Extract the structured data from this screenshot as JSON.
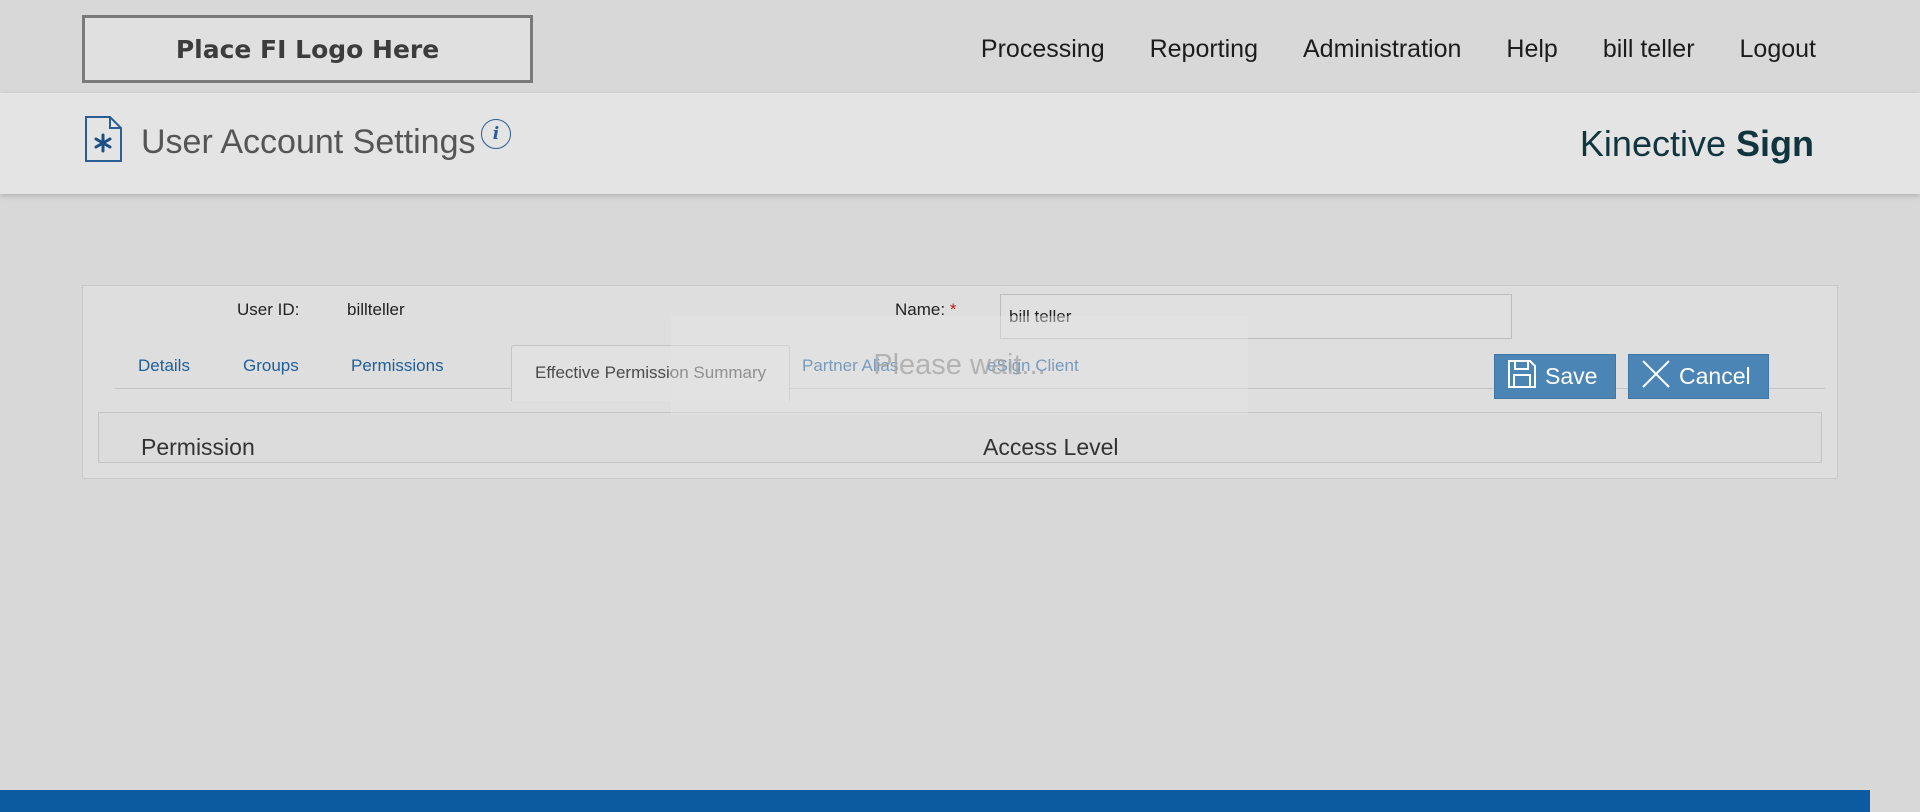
{
  "header": {
    "logo_text": "Place FI Logo Here",
    "nav": [
      "Processing",
      "Reporting",
      "Administration",
      "Help",
      "bill teller",
      "Logout"
    ]
  },
  "page": {
    "title": "User Account Settings",
    "info_glyph": "i",
    "brand_light": "Kinective",
    "brand_bold": "Sign"
  },
  "form": {
    "user_id_label": "User ID:",
    "user_id_value": "billteller",
    "name_label": "Name:",
    "required_mark": "*",
    "name_value": "bill teller"
  },
  "tabs": [
    "Details",
    "Groups",
    "Permissions",
    "Effective Permission Summary",
    "Partner Alias",
    "eSign Client"
  ],
  "active_tab": "Effective Permission Summary",
  "buttons": {
    "save": "Save",
    "cancel": "Cancel"
  },
  "table": {
    "columns": [
      "Permission",
      "Access Level"
    ]
  },
  "overlay": {
    "text": "Please wait..."
  },
  "colors": {
    "accent": "#4b85b5",
    "footer": "#0c5aa0",
    "link": "#1f5f9a",
    "required": "#c01a1a"
  },
  "icons": [
    "document-settings-icon",
    "info-icon",
    "save-icon",
    "close-icon"
  ]
}
